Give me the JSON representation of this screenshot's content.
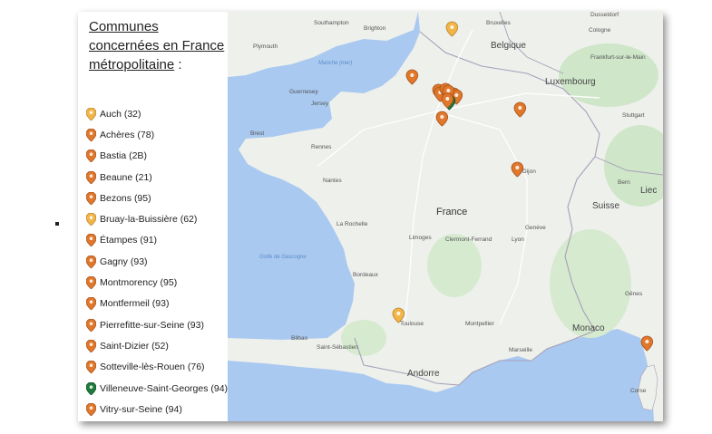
{
  "legend": {
    "title_underlined": "Communes concernées en France métropolitaine",
    "title_suffix": " :",
    "colors": {
      "orange": "#e0772b",
      "yellow": "#f1b54a",
      "green": "#1e7b3b"
    },
    "items": [
      {
        "label": "Auch (32)",
        "color": "yellow"
      },
      {
        "label": "Achères (78)",
        "color": "orange"
      },
      {
        "label": "Bastia (2B)",
        "color": "orange"
      },
      {
        "label": "Beaune (21)",
        "color": "orange"
      },
      {
        "label": "Bezons (95)",
        "color": "orange"
      },
      {
        "label": "Bruay-la-Buissière (62)",
        "color": "yellow"
      },
      {
        "label": "Étampes (91)",
        "color": "orange"
      },
      {
        "label": "Gagny (93)",
        "color": "orange"
      },
      {
        "label": "Montmorency (95)",
        "color": "orange"
      },
      {
        "label": "Montfermeil (93)",
        "color": "orange"
      },
      {
        "label": "Pierrefitte-sur-Seine (93)",
        "color": "orange"
      },
      {
        "label": "Saint-Dizier (52)",
        "color": "orange"
      },
      {
        "label": "Sotteville-lès-Rouen (76)",
        "color": "orange"
      },
      {
        "label": "Villeneuve-Saint-Georges (94)",
        "color": "green"
      },
      {
        "label": "Vitry-sur-Seine (94)",
        "color": "orange"
      }
    ]
  },
  "map": {
    "colors": {
      "water": "#a9c9f0",
      "land": "#eef0ec",
      "green": "#cfe6c9",
      "border": "#a6a0b8"
    },
    "labels": {
      "big": [
        "Belgique",
        "Luxembourg",
        "France",
        "Suisse",
        "Monaco",
        "Andorre",
        "Liec"
      ],
      "cities": [
        "Southampton",
        "Brighton",
        "Plymouth",
        "Guernesey",
        "Jersey",
        "Brest",
        "Rennes",
        "Nantes",
        "La Rochelle",
        "Bordeaux",
        "Limoges",
        "Clermont-Ferrand",
        "Lyon",
        "Genève",
        "Bern",
        "Dusseldorf",
        "Cologne",
        "Frankfurt-sur-le-Main",
        "Stuttgart",
        "Toulouse",
        "Montpellier",
        "Marseille",
        "Bilbao",
        "Saint-Sébastien",
        "Corse",
        "Gênes",
        "Bruxelles",
        "Dijon"
      ],
      "seas": [
        "Manche (mer)",
        "Golfe de Gascogne"
      ]
    }
  }
}
